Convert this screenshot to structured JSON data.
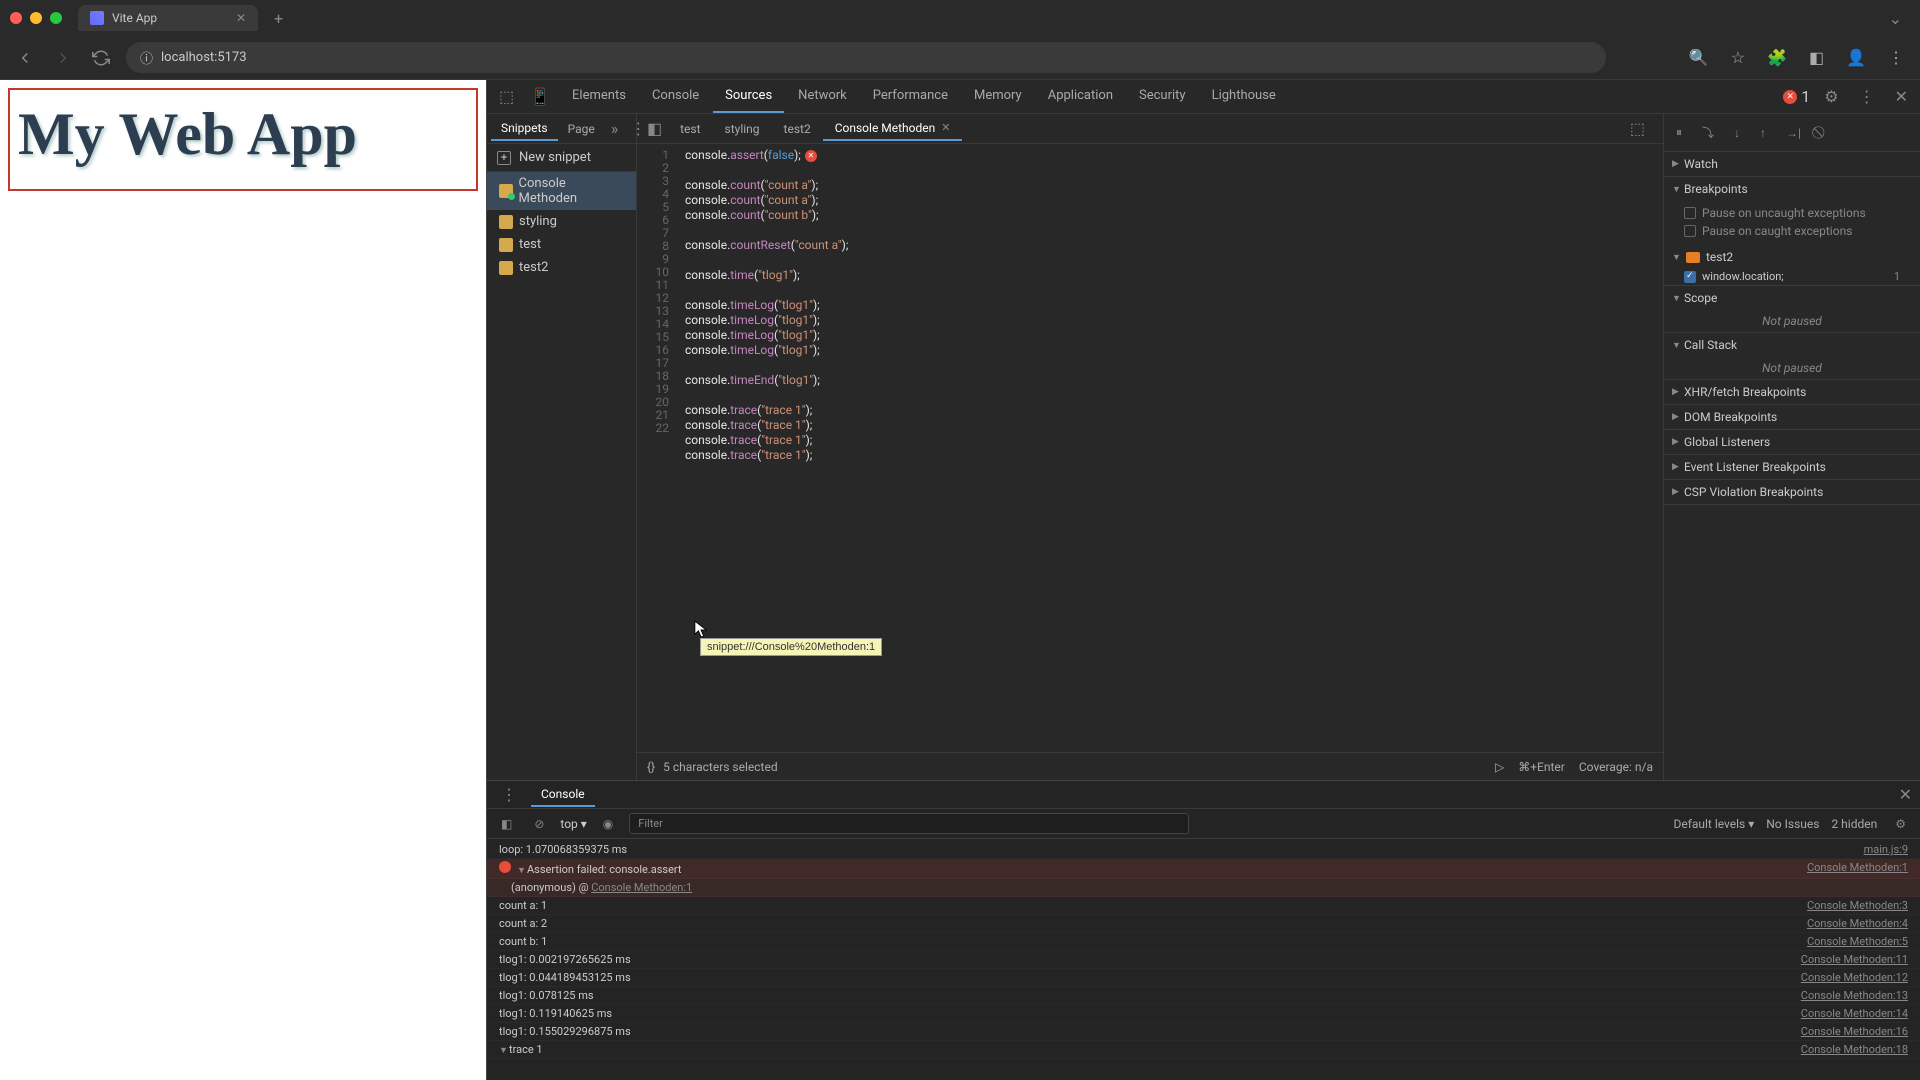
{
  "browser": {
    "tab_title": "Vite App",
    "url": "localhost:5173"
  },
  "page": {
    "heading": "My Web App"
  },
  "devtools": {
    "tabs": [
      "Elements",
      "Console",
      "Sources",
      "Network",
      "Performance",
      "Memory",
      "Application",
      "Security",
      "Lighthouse"
    ],
    "active_tab": "Sources",
    "error_count": "1"
  },
  "sources": {
    "left_tabs": [
      "Snippets",
      "Page"
    ],
    "new_snippet_label": "New snippet",
    "snippets": [
      {
        "name": "Console Methoden",
        "active": true,
        "running": true
      },
      {
        "name": "styling",
        "active": false
      },
      {
        "name": "test",
        "active": false
      },
      {
        "name": "test2",
        "active": false
      }
    ],
    "editor_tabs": [
      {
        "name": "test",
        "active": false
      },
      {
        "name": "styling",
        "active": false
      },
      {
        "name": "test2",
        "active": false
      },
      {
        "name": "Console Methoden",
        "active": true
      }
    ],
    "code_lines": [
      {
        "n": 1,
        "obj": "console.",
        "fn": "assert",
        "rest1": "(",
        "kw": "false",
        "rest2": ");",
        "err": true
      },
      {
        "n": 2,
        "blank": true
      },
      {
        "n": 3,
        "obj": "console.",
        "fn": "count",
        "rest1": "(",
        "str": "\"count a\"",
        "rest2": ");"
      },
      {
        "n": 4,
        "obj": "console.",
        "fn": "count",
        "rest1": "(",
        "str": "\"count a\"",
        "rest2": ");"
      },
      {
        "n": 5,
        "obj": "console.",
        "fn": "count",
        "rest1": "(",
        "str": "\"count b\"",
        "rest2": ");"
      },
      {
        "n": 6,
        "blank": true
      },
      {
        "n": 7,
        "obj": "console.",
        "fn": "countReset",
        "rest1": "(",
        "str": "\"count a\"",
        "rest2": ");"
      },
      {
        "n": 8,
        "blank": true
      },
      {
        "n": 9,
        "obj": "console.",
        "fn": "time",
        "rest1": "(",
        "str": "\"tlog1\"",
        "rest2": ");"
      },
      {
        "n": 10,
        "blank": true
      },
      {
        "n": 11,
        "obj": "console.",
        "fn": "timeLog",
        "rest1": "(",
        "str": "\"tlog1\"",
        "rest2": ");"
      },
      {
        "n": 12,
        "obj": "console.",
        "fn": "timeLog",
        "rest1": "(",
        "str": "\"tlog1\"",
        "rest2": ");"
      },
      {
        "n": 13,
        "obj": "console.",
        "fn": "timeLog",
        "rest1": "(",
        "str": "\"tlog1\"",
        "rest2": ");"
      },
      {
        "n": 14,
        "obj": "console.",
        "fn": "timeLog",
        "rest1": "(",
        "str": "\"tlog1\"",
        "rest2": ");"
      },
      {
        "n": 15,
        "blank": true
      },
      {
        "n": 16,
        "obj": "console.",
        "fn": "timeEnd",
        "rest1": "(",
        "str": "\"tlog1\"",
        "rest2": ");"
      },
      {
        "n": 17,
        "blank": true
      },
      {
        "n": 18,
        "obj": "console.",
        "fn": "trace",
        "rest1": "(",
        "str": "\"trace 1\"",
        "rest2": ");"
      },
      {
        "n": 19,
        "obj": "console.",
        "fn": "trace",
        "rest1": "(",
        "str": "\"trace 1\"",
        "rest2": ");"
      },
      {
        "n": 20,
        "obj": "console.",
        "fn": "trace",
        "rest1": "(",
        "str": "\"trace 1\"",
        "rest2": ");"
      },
      {
        "n": 21,
        "obj": "console.",
        "fn": "trace",
        "rest1": "(",
        "str": "\"trace 1\"",
        "rest2": ");"
      },
      {
        "n": 22,
        "blank": true
      }
    ],
    "status": {
      "selection": "5 characters selected",
      "run_hint": "⌘+Enter",
      "coverage": "Coverage: n/a"
    },
    "debugger": {
      "watch": "Watch",
      "breakpoints": "Breakpoints",
      "pause_uncaught": "Pause on uncaught exceptions",
      "pause_caught": "Pause on caught exceptions",
      "bp_group": "test2",
      "bp_item": "window.location;",
      "bp_item_line": "1",
      "scope": "Scope",
      "callstack": "Call Stack",
      "not_paused": "Not paused",
      "xhr": "XHR/fetch Breakpoints",
      "dom": "DOM Breakpoints",
      "global": "Global Listeners",
      "event": "Event Listener Breakpoints",
      "csp": "CSP Violation Breakpoints"
    }
  },
  "console": {
    "tab_label": "Console",
    "context": "top",
    "filter_placeholder": "Filter",
    "levels": "Default levels",
    "issues": "No Issues",
    "hidden": "2 hidden",
    "tooltip_text": "snippet:///Console%20Methoden:1",
    "rows": [
      {
        "msg": "loop: 1.070068359375 ms",
        "src": "main.js:9"
      },
      {
        "msg": "Assertion failed: console.assert",
        "src": "Console Methoden:1",
        "err": true,
        "expand": true,
        "err_icon": true
      },
      {
        "msg": "(anonymous) @ ",
        "link": "Console Methoden:1",
        "sub": true
      },
      {
        "msg": "count a: 1",
        "src": "Console Methoden:3"
      },
      {
        "msg": "count a: 2",
        "src": "Console Methoden:4"
      },
      {
        "msg": "count b: 1",
        "src": "Console Methoden:5"
      },
      {
        "msg": "tlog1: 0.002197265625 ms",
        "src": "Console Methoden:11"
      },
      {
        "msg": "tlog1: 0.044189453125 ms",
        "src": "Console Methoden:12"
      },
      {
        "msg": "tlog1: 0.078125 ms",
        "src": "Console Methoden:13"
      },
      {
        "msg": "tlog1: 0.119140625 ms",
        "src": "Console Methoden:14"
      },
      {
        "msg": "tlog1: 0.155029296875 ms",
        "src": "Console Methoden:16"
      },
      {
        "msg": "trace 1",
        "src": "Console Methoden:18",
        "expand": true
      }
    ]
  }
}
